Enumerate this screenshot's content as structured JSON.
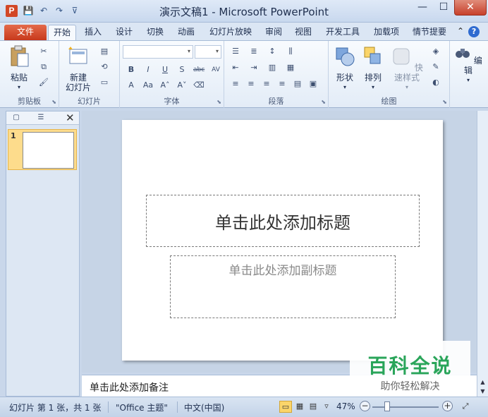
{
  "window": {
    "title": "演示文稿1 - Microsoft PowerPoint",
    "app_icon_letter": "P",
    "minimize": "—",
    "maximize": "☐",
    "close": "✕"
  },
  "qat": {
    "save": "💾",
    "undo": "↶",
    "redo": "↷",
    "customize": "⊽"
  },
  "tabs": {
    "file": "文件",
    "items": [
      "开始",
      "插入",
      "设计",
      "切换",
      "动画",
      "幻灯片放映",
      "审阅",
      "视图",
      "开发工具",
      "加载项",
      "情节提要"
    ],
    "active_index": 0,
    "collapse": "⌃",
    "help": "?"
  },
  "ribbon": {
    "groups": {
      "clipboard": "剪贴板",
      "slides": "幻灯片",
      "font": "字体",
      "paragraph": "段落",
      "drawing": "绘图"
    },
    "buttons": {
      "paste": "粘贴",
      "new_slide_line1": "新建",
      "new_slide_line2": "幻灯片",
      "shapes": "形状",
      "arrange": "排列",
      "quick_styles": "快速样式",
      "edit": "编辑"
    },
    "font_small": [
      "B",
      "I",
      "U",
      "S",
      "abc",
      "AV"
    ],
    "font_small2": [
      "A",
      "Aa",
      "A˄",
      "A˅"
    ]
  },
  "left_pane": {
    "slide_number": "1",
    "close": "✕"
  },
  "slide": {
    "title_placeholder": "单击此处添加标题",
    "subtitle_placeholder": "单击此处添加副标题"
  },
  "notes": {
    "placeholder": "单击此处添加备注"
  },
  "watermark": {
    "title": "百科全说",
    "subtitle": "助你轻松解决"
  },
  "status": {
    "slide_info": "幻灯片 第 1 张，共 1 张",
    "theme": "\"Office 主题\"",
    "language": "中文(中国)",
    "zoom": "47%"
  },
  "colors": {
    "file_tab": "#c7391c",
    "accent": "#2b579a",
    "watermark_green": "#2aa55a"
  }
}
